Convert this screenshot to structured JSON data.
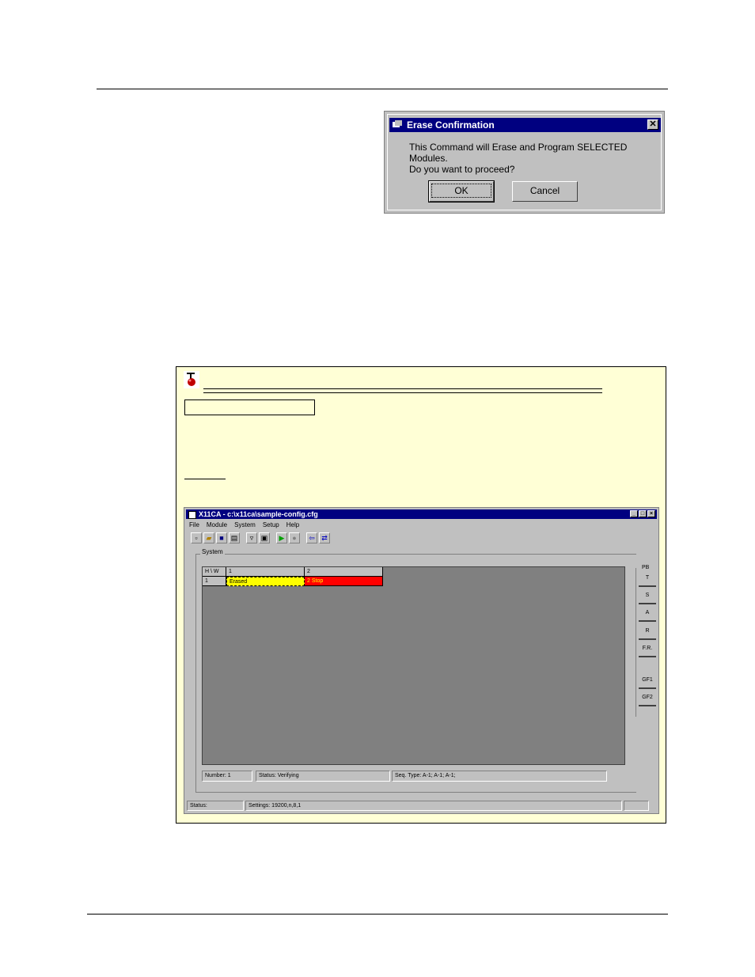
{
  "dialog": {
    "title": "Erase Confirmation",
    "close_glyph": "✕",
    "message_line1": "This Command will Erase and Program  SELECTED Modules.",
    "message_line2": "Do you want to proceed?",
    "ok_label": "OK",
    "cancel_label": "Cancel"
  },
  "note": {
    "icon": "tip-pin-icon"
  },
  "app": {
    "title": "X11CA - c:\\x11ca\\sample-config.cfg",
    "menu": [
      "File",
      "Module",
      "System",
      "Setup",
      "Help"
    ],
    "group_label": "System",
    "grid": {
      "headers": [
        "H \\ W",
        "1",
        "2"
      ],
      "row_label": "1",
      "cell1": "Erased",
      "cell2": "2 Stop",
      "cell1_color": "#ffff00",
      "cell2_color": "#ff0000"
    },
    "side_label": "PB",
    "side_buttons": [
      "T",
      "S",
      "A",
      "R",
      "F.R.",
      "GF1",
      "GF2"
    ],
    "status_number": "Number:  1",
    "status_state": "Status: Verifying",
    "status_seq": "Seq. Type:  A-1;  A-1;  A-1;",
    "status_label": "Status:",
    "settings": "Settings: 19200,n,8,1"
  }
}
